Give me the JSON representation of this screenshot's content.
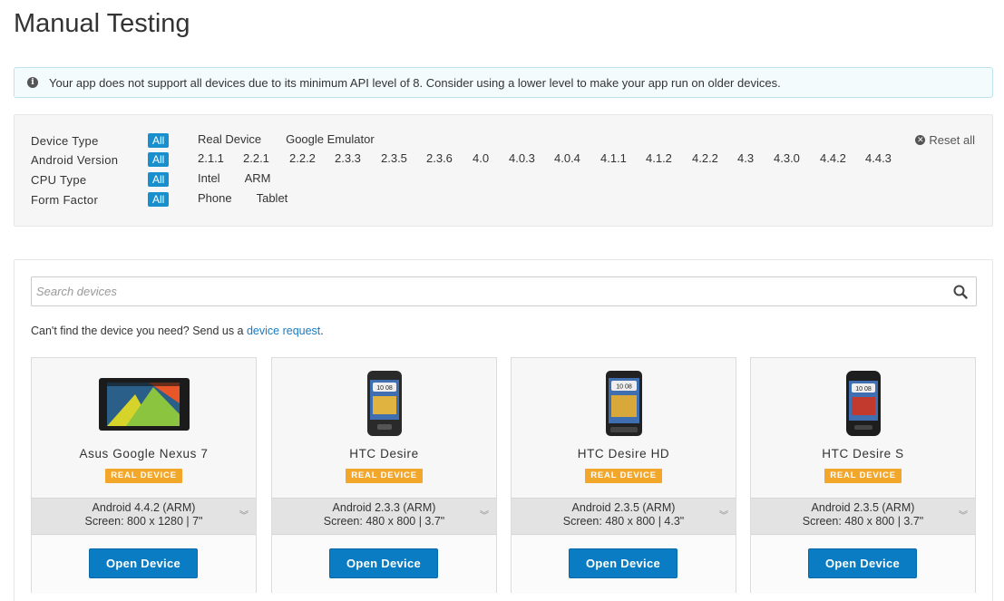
{
  "page": {
    "title": "Manual Testing"
  },
  "alert": {
    "text": "Your app does not support all devices due to its minimum API level of 8. Consider using a lower level to make your app run on older devices."
  },
  "filters": {
    "reset_label": "Reset all",
    "all_label": "All",
    "device_type": {
      "label": "Device Type",
      "options": [
        "Real Device",
        "Google Emulator"
      ]
    },
    "android_version": {
      "label": "Android Version",
      "options": [
        "2.1.1",
        "2.2.1",
        "2.2.2",
        "2.3.3",
        "2.3.5",
        "2.3.6",
        "4.0",
        "4.0.3",
        "4.0.4",
        "4.1.1",
        "4.1.2",
        "4.2.2",
        "4.3",
        "4.3.0",
        "4.4.2",
        "4.4.3"
      ]
    },
    "cpu_type": {
      "label": "CPU Type",
      "options": [
        "Intel",
        "ARM"
      ]
    },
    "form_factor": {
      "label": "Form Factor",
      "options": [
        "Phone",
        "Tablet"
      ]
    }
  },
  "search": {
    "placeholder": "Search devices"
  },
  "request": {
    "prefix": "Can't find the device you need? Send us a ",
    "link": "device request",
    "suffix": "."
  },
  "devices": [
    {
      "name": "Asus Google Nexus 7",
      "badge": "REAL DEVICE",
      "os": "Android 4.4.2 (ARM)",
      "screen": "Screen: 800 x 1280 | 7\"",
      "button": "Open Device"
    },
    {
      "name": "HTC Desire",
      "badge": "REAL DEVICE",
      "os": "Android 2.3.3 (ARM)",
      "screen": "Screen: 480 x 800 | 3.7\"",
      "button": "Open Device"
    },
    {
      "name": "HTC Desire HD",
      "badge": "REAL DEVICE",
      "os": "Android 2.3.5 (ARM)",
      "screen": "Screen: 480 x 800 | 4.3\"",
      "button": "Open Device"
    },
    {
      "name": "HTC Desire S",
      "badge": "REAL DEVICE",
      "os": "Android 2.3.5 (ARM)",
      "screen": "Screen: 480 x 800 | 3.7\"",
      "button": "Open Device"
    }
  ],
  "colors": {
    "accent": "#0a7cc4",
    "badge": "#f2a72a",
    "link": "#1a7ac0",
    "alert_bg": "#f4fbfd"
  },
  "icons": {
    "alert": "info-circle-icon",
    "reset": "close-circle-icon",
    "search": "search-icon",
    "expand": "chevron-double-down-icon"
  }
}
